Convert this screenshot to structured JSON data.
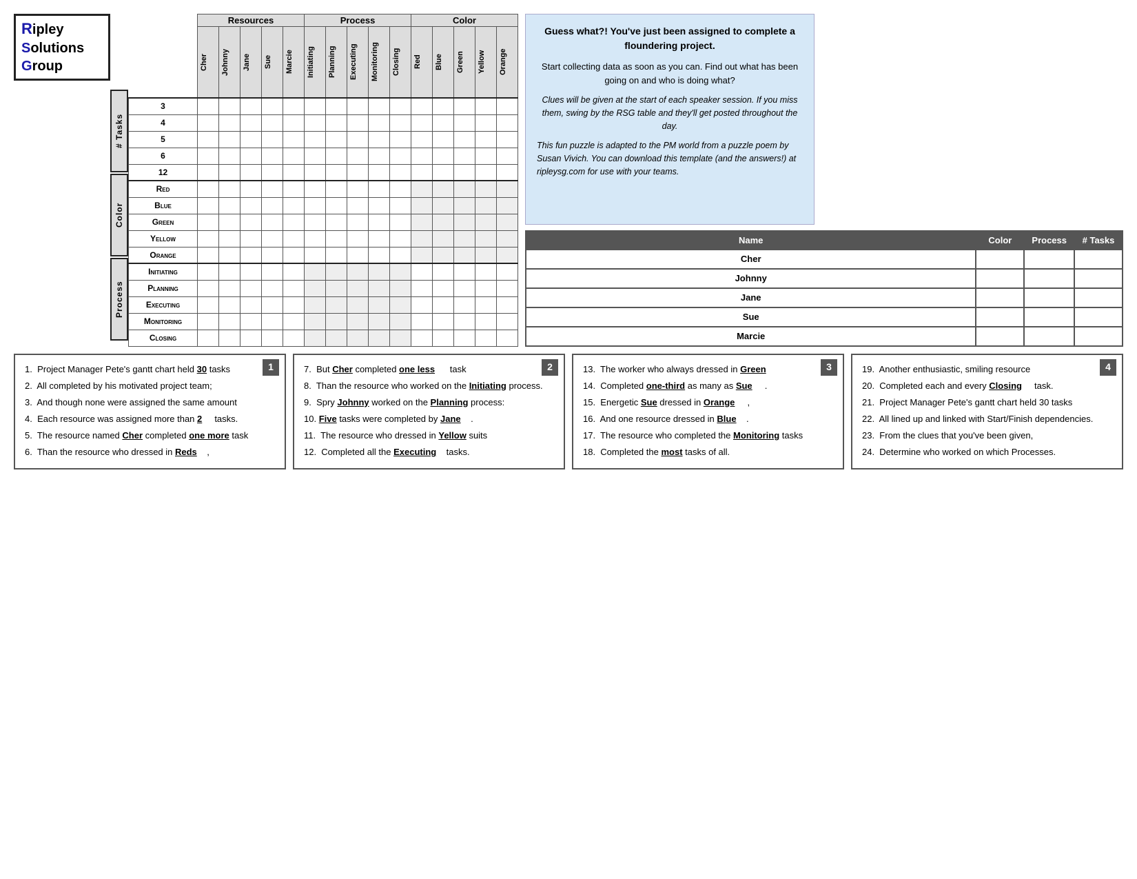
{
  "logo": {
    "line1": "ipley",
    "line2": "olutions",
    "line3": "roup",
    "r": "R",
    "s": "S",
    "g": "G"
  },
  "header_sections": {
    "resources": "Resources",
    "process": "Process",
    "color": "Color"
  },
  "col_headers": {
    "resources": [
      "Cher",
      "Johnny",
      "Jane",
      "Sue",
      "Marcie"
    ],
    "process": [
      "Initiating",
      "Planning",
      "Executing",
      "Monitoring",
      "Closing"
    ],
    "color": [
      "Red",
      "Blue",
      "Green",
      "Yellow",
      "Orange"
    ]
  },
  "row_groups": {
    "tasks": {
      "label": "# Tasks",
      "rows": [
        "3",
        "4",
        "5",
        "6",
        "12"
      ]
    },
    "color": {
      "label": "Color",
      "rows": [
        "Red",
        "Blue",
        "Green",
        "Yellow",
        "Orange"
      ]
    },
    "process": {
      "label": "Process",
      "rows": [
        "Initiating",
        "Planning",
        "Executing",
        "Monitoring",
        "Closing"
      ]
    }
  },
  "info_panel": {
    "headline": "Guess what?! You've just been assigned to complete a floundering project.",
    "body": "Start collecting data as soon as you can.  Find out what has been going on and who is doing what?",
    "italic1": "Clues will be given at the start of each speaker session.  If you miss them, swing by the RSG table and they'll get posted throughout the day.",
    "italic2": "This fun puzzle is adapted to the PM world from a puzzle poem by Susan Vivich.  You can download this template (and the answers!) at ripleysg.com for use with your teams."
  },
  "summary_table": {
    "headers": [
      "Name",
      "Color",
      "Process",
      "# Tasks"
    ],
    "rows": [
      {
        "name": "Cher"
      },
      {
        "name": "Johnny"
      },
      {
        "name": "Jane"
      },
      {
        "name": "Sue"
      },
      {
        "name": "Marcie"
      }
    ]
  },
  "clues": {
    "box1": {
      "number": "1",
      "items": [
        "1.  Project Manager Pete's gantt chart held __30__ tasks",
        "2.  All completed by his motivated project team;",
        "3.  And though none were assigned the same amount",
        "4.  Each resource was assigned more than __2____ tasks.",
        "5.  The resource named __Cher__ completed _one more_task",
        "6.  Than the resource who dressed in __Reds___ ,"
      ]
    },
    "box2": {
      "number": "2",
      "items": [
        "7.  But __Cher_ completed _one less_____ task",
        "8.  Than the resource who worked on the _Initiating_ process.",
        "9.  Spry __Johnny__ worked on the _Planning_ process:",
        "10.  _Five_ tasks were completed by _Jane____.",
        "11.  The resource who dressed in _Yellow_ suits",
        "12.  Completed all the _Executing___ tasks."
      ]
    },
    "box3": {
      "number": "3",
      "items": [
        "13.  The worker who always dressed in _Green____",
        "14.  Completed _one-third_ as many as _Sue_____.",
        "15.  Energetic _Sue__ dressed in _Orange____ ,",
        "16.  And one resource dressed in _Blue____.",
        "17.  The resource who completed the __Monitoring_ tasks",
        "18.  Completed the _most_ tasks of all."
      ]
    },
    "box4": {
      "number": "4",
      "items": [
        "19.  Another enthusiastic, smiling resource",
        "20.  Completed each and every _Closing____ task.",
        "21.  Project Manager Pete's gantt chart held 30 tasks",
        "22.  All lined up and linked with Start/Finish dependencies.",
        "23.  From the clues that you've been given,",
        "24.  Determine who worked on which Processes."
      ]
    }
  }
}
